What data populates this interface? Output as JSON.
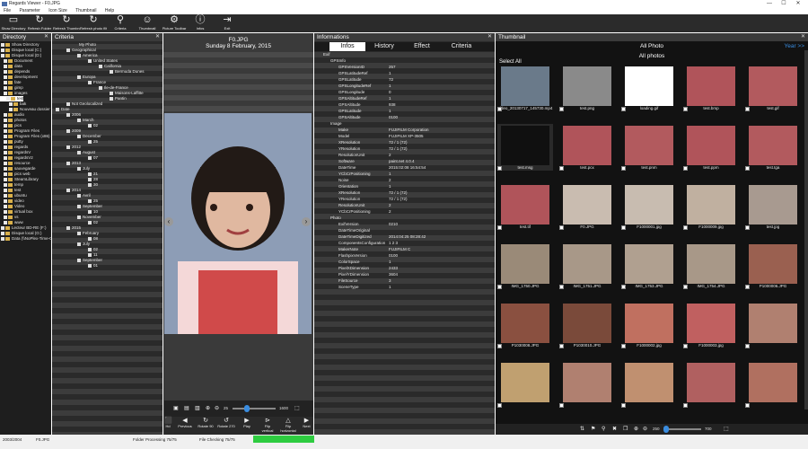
{
  "window": {
    "title": "Regards Viewer - F0.JPG",
    "controls": [
      "—",
      "☐",
      "✕"
    ]
  },
  "menu": [
    "File",
    "Parameter",
    "Icon Size",
    "Thumbnail",
    "Help"
  ],
  "toolbar": [
    {
      "label": "Show Directory",
      "icon": "folder-icon"
    },
    {
      "label": "Refresh Folder",
      "icon": "refresh-icon"
    },
    {
      "label": "Refresh Thumbnail",
      "icon": "refresh-icon"
    },
    {
      "label": "Refresh photo filter",
      "icon": "refresh-icon"
    },
    {
      "label": "Criteria",
      "icon": "search-icon"
    },
    {
      "label": "Thumbnail",
      "icon": "faces-icon"
    },
    {
      "label": "Picture Toolbar",
      "icon": "gear-icon"
    },
    {
      "label": "Infos",
      "icon": "info-icon"
    },
    {
      "label": "Exit",
      "icon": "exit-icon"
    }
  ],
  "directory": {
    "title": "Directory",
    "items": [
      "Show Directory",
      "Disque local (C:)",
      "Disque local (D:)",
      "Document",
      "data",
      "depends",
      "development",
      "fate",
      "gimp",
      "images",
      "test",
      "bak",
      "Nouveau dossier",
      "audio",
      "photos",
      "pics",
      "Program Files",
      "Program Files (x86)",
      "putty",
      "regards",
      "regardsV",
      "regardsV2",
      "resource",
      "sauvegarde",
      "pics web",
      "SteamLibrary",
      "temp",
      "test",
      "ubuntu",
      "video",
      "Video",
      "virtual box",
      "vs",
      "www",
      "Lecteur BD-RE (F:)",
      "Disque local (G:)",
      "Data (\\\\NoPlex-Time-Ca"
    ]
  },
  "criteria": {
    "title": "Criteria",
    "rows": [
      "My Photo",
      "Geographical",
      "America",
      "United States",
      "California",
      "Bermuda Dunes",
      "Europa",
      "France",
      "Ile-de-France",
      "Maisons-Laffitte",
      "Pantin",
      "Not Geolocalized",
      "Date",
      "2006",
      "March",
      "02",
      "2009",
      "December",
      "25",
      "2012",
      "August",
      "07",
      "2013",
      "July",
      "21",
      "28",
      "30",
      "2014",
      "Avril",
      "25",
      "September",
      "10",
      "November",
      "02",
      "2015",
      "February",
      "08",
      "July",
      "02",
      "11",
      "September",
      "01"
    ]
  },
  "viewer": {
    "filename": "F0.JPG",
    "date": "Sunday 8 February, 2015",
    "zoom_start": "25",
    "zoom_end": "1600",
    "zoom_level": 0.32,
    "buttons": [
      "Hd",
      "Previous",
      "Rotate 90",
      "Rotate 270",
      "Play",
      "Flip vertical",
      "Flip horizontal",
      "Next"
    ]
  },
  "infos": {
    "title": "Informations",
    "tabs": [
      "Infos",
      "History",
      "Effect",
      "Criteria"
    ],
    "rows": [
      [
        "Exif",
        ""
      ],
      [
        "GPSInfo",
        ""
      ],
      [
        "GPSVersionID",
        "257"
      ],
      [
        "GPSLatitudeRef",
        "1"
      ],
      [
        "GPSLatitude",
        "72"
      ],
      [
        "GPSLongitudeRef",
        "1"
      ],
      [
        "GPSLongitude",
        "0"
      ],
      [
        "GPSAltitudeRef",
        "1"
      ],
      [
        "GPSAltitude",
        "938"
      ],
      [
        "GPSLatitude",
        "1"
      ],
      [
        "GPSAltitude",
        "0100"
      ],
      [
        "Image",
        ""
      ],
      [
        "Make",
        "FUJIFILM Corporation"
      ],
      [
        "Model",
        "FUJIFILM XP-3505"
      ],
      [
        "XResolution",
        "72 / 1 (72)"
      ],
      [
        "YResolution",
        "72 / 1 (72)"
      ],
      [
        "ResolutionUnit",
        "2"
      ],
      [
        "Software",
        "paint.net 4.0.4"
      ],
      [
        "DateTime",
        "2015:02:08 16:54:54"
      ],
      [
        "YCbCrPositioning",
        "1"
      ],
      [
        "Noise",
        "2"
      ],
      [
        "Orientation",
        "1"
      ],
      [
        "XResolution",
        "72 / 1 (72)"
      ],
      [
        "YResolution",
        "72 / 1 (72)"
      ],
      [
        "ResolutionUnit",
        "2"
      ],
      [
        "YCbCrPositioning",
        "2"
      ],
      [
        "Photo",
        ""
      ],
      [
        "ExifVersion",
        "0210"
      ],
      [
        "DateTimeOriginal",
        ""
      ],
      [
        "DateTimeDigitized",
        "2014:04:25 08:28:42"
      ],
      [
        "ComponentsConfiguration",
        "1 2 3"
      ],
      [
        "MakerNote",
        "FUJIFILM C"
      ],
      [
        "FlashpixVersion",
        "0100"
      ],
      [
        "ColorSpace",
        "1"
      ],
      [
        "PixelXDimension",
        "2433"
      ],
      [
        "PixelYDimension",
        "3604"
      ],
      [
        "FileSource",
        "3"
      ],
      [
        "SceneType",
        "1"
      ]
    ]
  },
  "thumbnail": {
    "title": "Thumbnail",
    "all_photo": "All Photo",
    "year": "Year >>",
    "all_photos": "All photos",
    "select_all": "Select All",
    "items": [
      {
        "cap": "video_20130717_145730.mp4",
        "color": "#6a7a8a"
      },
      {
        "cap": "test.png",
        "color": "#8a8a8a"
      },
      {
        "cap": "loading.gif",
        "color": "#ffffff"
      },
      {
        "cap": "test.bmp",
        "color": "#b0545a"
      },
      {
        "cap": "test.gif",
        "color": "#b25a5e"
      },
      {
        "cap": "test.msg",
        "color": "#101010"
      },
      {
        "cap": "test.pcx",
        "color": "#b0545a"
      },
      {
        "cap": "test.pnm",
        "color": "#b25a5e"
      },
      {
        "cap": "test.ppm",
        "color": "#b0545a"
      },
      {
        "cap": "test.tga",
        "color": "#b25a5e"
      },
      {
        "cap": "test.tif",
        "color": "#b0545a"
      },
      {
        "cap": "F0.JPG",
        "color": "#c9bcb0"
      },
      {
        "cap": "F1000001.jpg",
        "color": "#c8bcb0"
      },
      {
        "cap": "F1000009.jpg",
        "color": "#c0b0a0"
      },
      {
        "cap": "test.jpg",
        "color": "#a89a90"
      },
      {
        "cap": "IMG_1750.JPG",
        "color": "#9a8a78"
      },
      {
        "cap": "IMG_1751.JPG",
        "color": "#a89888"
      },
      {
        "cap": "IMG_1753.JPG",
        "color": "#b0a090"
      },
      {
        "cap": "IMG_1754.JPG",
        "color": "#a89888"
      },
      {
        "cap": "P1000006.JPG",
        "color": "#9a6050"
      },
      {
        "cap": "P1030008.JPG",
        "color": "#8a5040"
      },
      {
        "cap": "P1030010.JPG",
        "color": "#7a4a3a"
      },
      {
        "cap": "F1000002.jpg",
        "color": "#c07060"
      },
      {
        "cap": "F1000003.jpg",
        "color": "#c06060"
      },
      {
        "cap": "",
        "color": "#b08070"
      },
      {
        "cap": "",
        "color": "#c0a070"
      },
      {
        "cap": "",
        "color": "#b08070"
      },
      {
        "cap": "",
        "color": "#c09070"
      },
      {
        "cap": "",
        "color": "#b06060"
      },
      {
        "cap": "",
        "color": "#b07060"
      }
    ],
    "zoom_start": "250",
    "zoom_end": "700"
  },
  "status": {
    "left": "2003/2004",
    "file": "F0.JPG",
    "folder": "Folder Processing 75/75",
    "checking": "File Checking 75/75"
  }
}
